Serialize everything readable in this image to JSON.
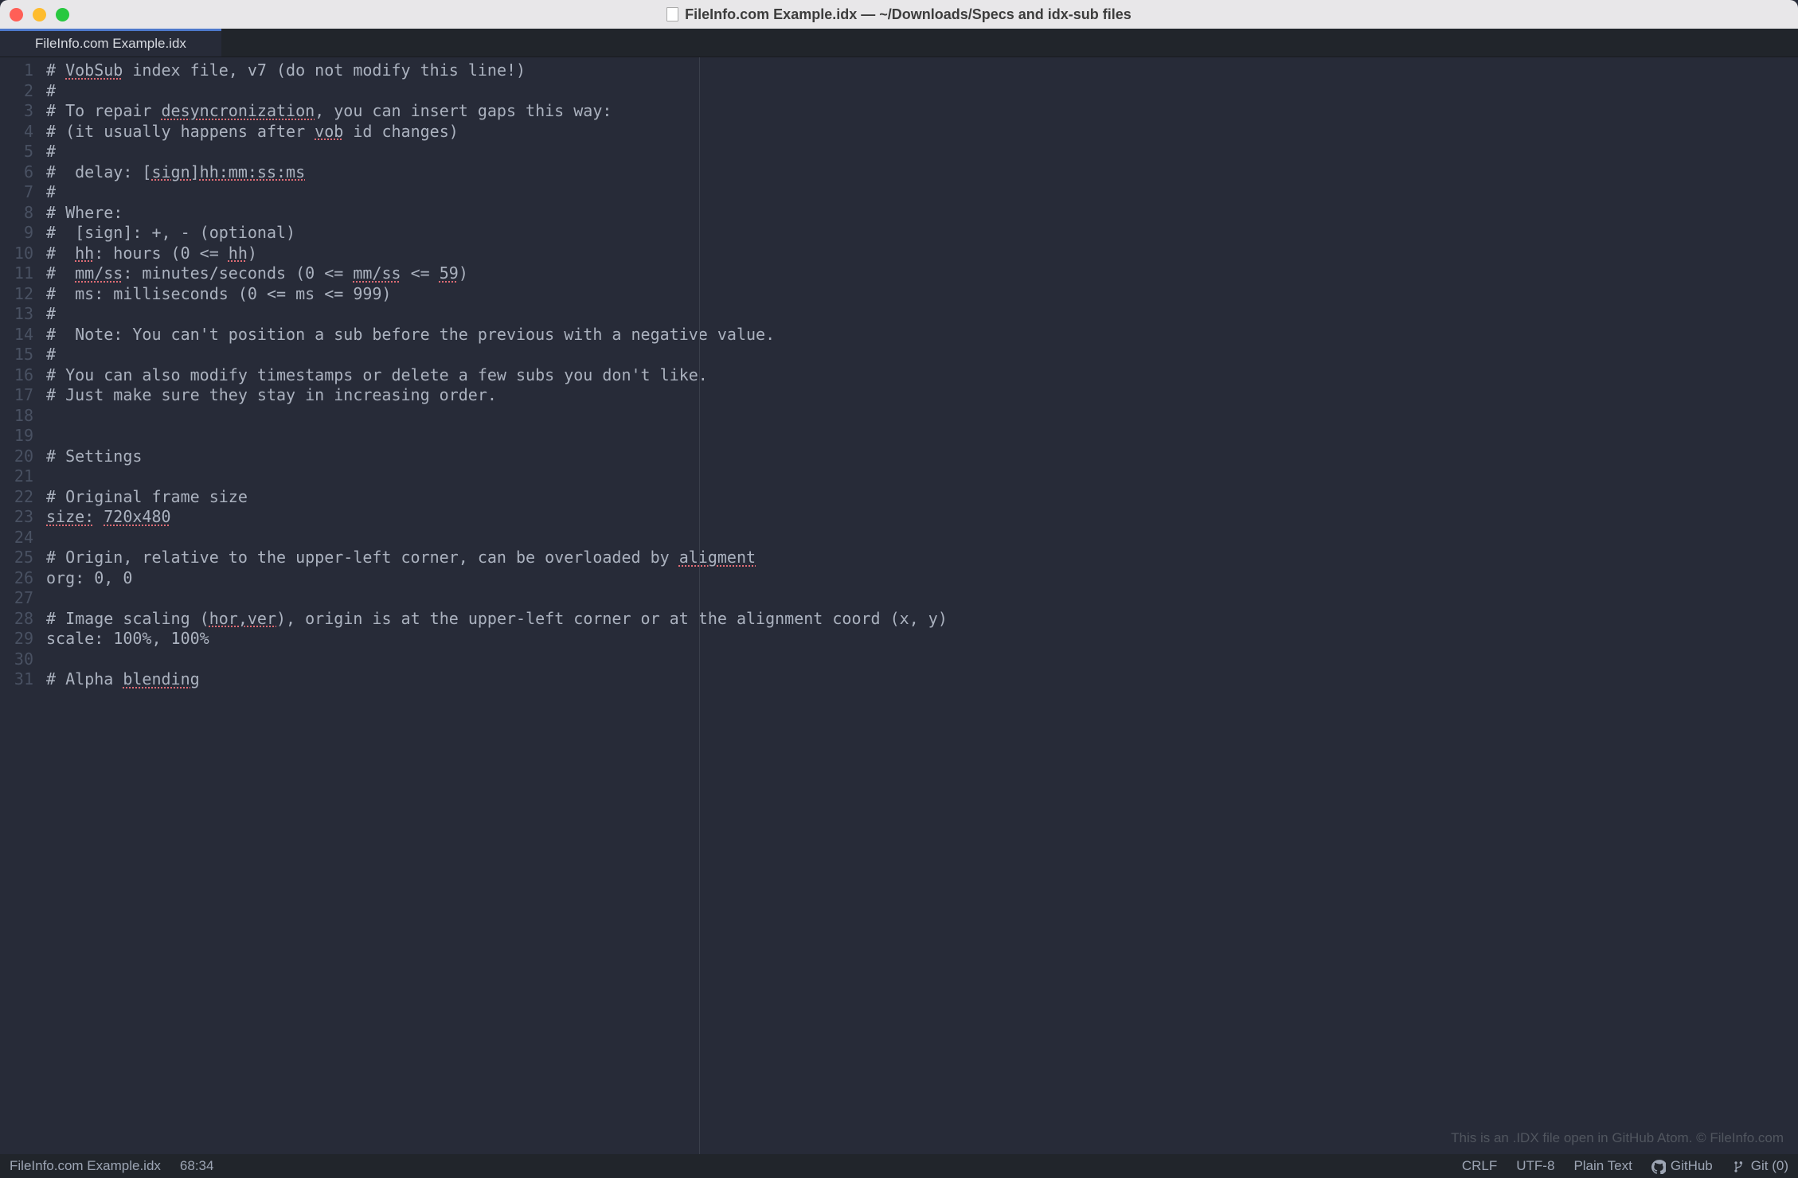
{
  "window": {
    "title": "FileInfo.com Example.idx — ~/Downloads/Specs and idx-sub files"
  },
  "tab": {
    "label": "FileInfo.com Example.idx"
  },
  "editor": {
    "lines": [
      {
        "n": 1,
        "segs": [
          {
            "t": "# "
          },
          {
            "t": "VobSub",
            "err": true
          },
          {
            "t": " index file, v7 (do not modify this line!)"
          }
        ]
      },
      {
        "n": 2,
        "segs": [
          {
            "t": "#"
          }
        ]
      },
      {
        "n": 3,
        "segs": [
          {
            "t": "# To repair "
          },
          {
            "t": "desyncronization",
            "err": true
          },
          {
            "t": ", you can insert gaps this way:"
          }
        ]
      },
      {
        "n": 4,
        "segs": [
          {
            "t": "# (it usually happens after "
          },
          {
            "t": "vob",
            "err": true
          },
          {
            "t": " id changes)"
          }
        ]
      },
      {
        "n": 5,
        "segs": [
          {
            "t": "#"
          }
        ]
      },
      {
        "n": 6,
        "segs": [
          {
            "t": "#  delay: ["
          },
          {
            "t": "sign]hh:mm:ss:ms",
            "err": true
          }
        ]
      },
      {
        "n": 7,
        "segs": [
          {
            "t": "#"
          }
        ]
      },
      {
        "n": 8,
        "segs": [
          {
            "t": "# Where:"
          }
        ]
      },
      {
        "n": 9,
        "segs": [
          {
            "t": "#  [sign]: +, - (optional)"
          }
        ]
      },
      {
        "n": 10,
        "segs": [
          {
            "t": "#  "
          },
          {
            "t": "hh",
            "err": true
          },
          {
            "t": ": hours (0 <= "
          },
          {
            "t": "hh",
            "err": true
          },
          {
            "t": ")"
          }
        ]
      },
      {
        "n": 11,
        "segs": [
          {
            "t": "#  "
          },
          {
            "t": "mm/ss",
            "err": true
          },
          {
            "t": ": minutes/seconds (0 <= "
          },
          {
            "t": "mm/ss",
            "err": true
          },
          {
            "t": " <= "
          },
          {
            "t": "59",
            "err": true
          },
          {
            "t": ")"
          }
        ]
      },
      {
        "n": 12,
        "segs": [
          {
            "t": "#  ms: milliseconds (0 <= ms <= 999)"
          }
        ]
      },
      {
        "n": 13,
        "segs": [
          {
            "t": "#"
          }
        ]
      },
      {
        "n": 14,
        "segs": [
          {
            "t": "#  Note: You can't position a sub before the previous with a negative value."
          }
        ]
      },
      {
        "n": 15,
        "segs": [
          {
            "t": "#"
          }
        ]
      },
      {
        "n": 16,
        "segs": [
          {
            "t": "# You can also modify timestamps or delete a few subs you don't like."
          }
        ]
      },
      {
        "n": 17,
        "segs": [
          {
            "t": "# Just make sure they stay in increasing order."
          }
        ]
      },
      {
        "n": 18,
        "segs": [
          {
            "t": ""
          }
        ]
      },
      {
        "n": 19,
        "segs": [
          {
            "t": ""
          }
        ]
      },
      {
        "n": 20,
        "segs": [
          {
            "t": "# Settings"
          }
        ]
      },
      {
        "n": 21,
        "segs": [
          {
            "t": ""
          }
        ]
      },
      {
        "n": 22,
        "segs": [
          {
            "t": "# Original frame size"
          }
        ]
      },
      {
        "n": 23,
        "segs": [
          {
            "t": "size:",
            "err": true
          },
          {
            "t": " "
          },
          {
            "t": "720x480",
            "err": true
          }
        ]
      },
      {
        "n": 24,
        "segs": [
          {
            "t": ""
          }
        ]
      },
      {
        "n": 25,
        "segs": [
          {
            "t": "# Origin, relative to the upper-left corner, can be overloaded by "
          },
          {
            "t": "aligment",
            "err": true
          }
        ]
      },
      {
        "n": 26,
        "segs": [
          {
            "t": "org: 0, 0"
          }
        ]
      },
      {
        "n": 27,
        "segs": [
          {
            "t": ""
          }
        ]
      },
      {
        "n": 28,
        "segs": [
          {
            "t": "# Image scaling ("
          },
          {
            "t": "hor,ver",
            "err": true
          },
          {
            "t": "), origin is at the upper-left corner or at the alignment coord (x, y)"
          }
        ]
      },
      {
        "n": 29,
        "segs": [
          {
            "t": "scale: 100%, 100%"
          }
        ]
      },
      {
        "n": 30,
        "segs": [
          {
            "t": ""
          }
        ]
      },
      {
        "n": 31,
        "segs": [
          {
            "t": "# Alpha "
          },
          {
            "t": "blending",
            "err": true
          }
        ]
      }
    ]
  },
  "watermark": "This is an .IDX file open in GitHub Atom. © FileInfo.com",
  "status": {
    "file": "FileInfo.com Example.idx",
    "cursor": "68:34",
    "eol": "CRLF",
    "encoding": "UTF-8",
    "grammar": "Plain Text",
    "github": "GitHub",
    "git": "Git (0)"
  }
}
